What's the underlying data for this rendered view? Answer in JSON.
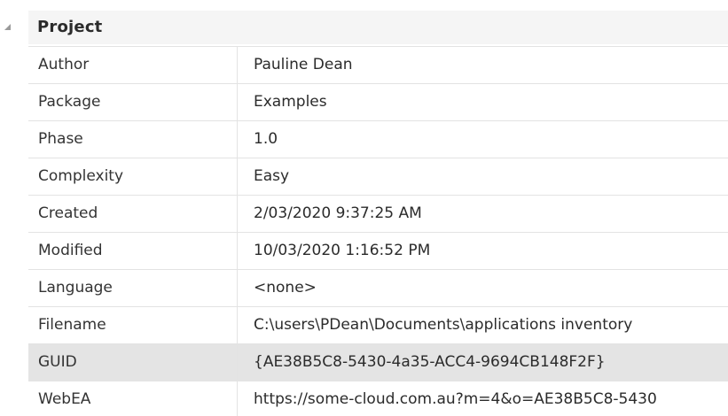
{
  "section": {
    "title": "Project",
    "expanded": true
  },
  "rows": [
    {
      "name": "Author",
      "value": "Pauline Dean",
      "selected": false
    },
    {
      "name": "Package",
      "value": "Examples",
      "selected": false
    },
    {
      "name": "Phase",
      "value": "1.0",
      "selected": false
    },
    {
      "name": "Complexity",
      "value": "Easy",
      "selected": false
    },
    {
      "name": "Created",
      "value": "2/03/2020 9:37:25 AM",
      "selected": false
    },
    {
      "name": "Modified",
      "value": "10/03/2020 1:16:52 PM",
      "selected": false
    },
    {
      "name": "Language",
      "value": "<none>",
      "selected": false
    },
    {
      "name": "Filename",
      "value": "C:\\users\\PDean\\Documents\\applications inventory",
      "selected": false
    },
    {
      "name": "GUID",
      "value": "{AE38B5C8-5430-4a35-ACC4-9694CB148F2F}",
      "selected": true
    },
    {
      "name": "WebEA",
      "value": "https://some-cloud.com.au?m=4&o=AE38B5C8-5430",
      "selected": false
    }
  ],
  "colors": {
    "header_background": "#f5f5f5",
    "selected_row_background": "#e4e4e4",
    "grid_line": "#e3e3e3",
    "text": "#2b2b2b"
  }
}
